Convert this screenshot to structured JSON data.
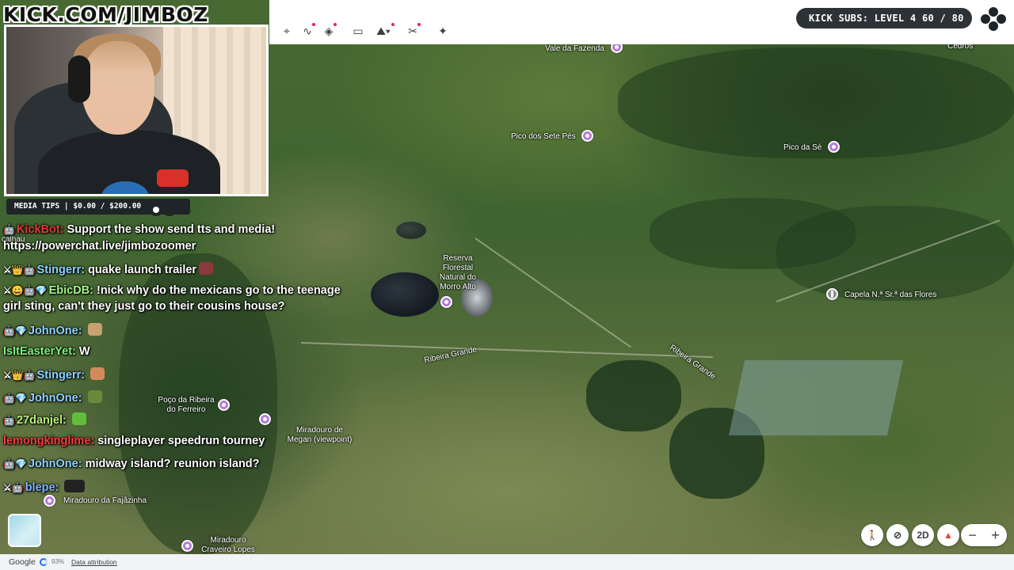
{
  "stream": {
    "brand": "KICK.COM/JIMBOZ",
    "media_tips": "MEDIA TIPS | $0.00 / $200.00",
    "kick_subs": "KICK SUBS: LEVEL 4 60 / 80"
  },
  "map": {
    "places": {
      "vale_da_fazenda": "Vale da Fazenda",
      "cedros": "Cedros",
      "pico_dos_sete_pes": "Pico dos Sete Pés",
      "pico_da_se": "Pico da Sé",
      "reserva": "Reserva\nFlorestal\nNatural do\nMorro Alto",
      "capela": "Capela N.ª Sr.ª das Flores",
      "ribeira_grande_1": "Ribeira Grande",
      "ribeira_grande_2": "Ribeira Grande",
      "poco_da_ribeira": "Poço da Ribeira\ndo Ferreiro",
      "miradouro_megan": "Miradouro de\nMegan (viewpoint)",
      "miradouro_fajazinha": "Miradouro da Fajãzinha",
      "miradouro_craveiro": "Miradouro\nCraveiro Lopes",
      "calhau": "calhau"
    },
    "controls": {
      "btn_2d": "2D"
    }
  },
  "footer": {
    "google": "Google",
    "percent": "93%",
    "attribution": "Data attribution"
  },
  "chat": {
    "messages": [
      {
        "user": "KickBot:",
        "text": "Support the show send tts and media!",
        "user_color": "#e33a3a"
      },
      {
        "user": "",
        "text": "https://powerchat.live/jimbozoomer",
        "user_color": "#ffffff"
      },
      {
        "user": "Stingerr:",
        "text": "quake launch trailer",
        "user_color": "#8fd3ff"
      },
      {
        "user": "EbicDB:",
        "text": "!nick why do the mexicans go to the teenage",
        "user_color": "#a6f28b"
      },
      {
        "user": "",
        "text": "girl sting, can't they just go to their cousins house?",
        "user_color": "#ffffff"
      },
      {
        "user": "JohnOne:",
        "text": "",
        "user_color": "#8fd3ff"
      },
      {
        "user": "IsItEasterYet:",
        "text": "W",
        "user_color": "#7ef07e"
      },
      {
        "user": "Stingerr:",
        "text": "",
        "user_color": "#8fd3ff"
      },
      {
        "user": "JohnOne:",
        "text": "",
        "user_color": "#8fd3ff"
      },
      {
        "user": "27danjel:",
        "text": "",
        "user_color": "#b7f27a"
      },
      {
        "user": "lemongkinglime:",
        "text": "singleplayer speedrun tourney",
        "user_color": "#ff3b3b"
      },
      {
        "user": "JohnOne:",
        "text": "midway island? reunion island?",
        "user_color": "#8fd3ff"
      },
      {
        "user": "blepe:",
        "text": "",
        "user_color": "#7fb6ff"
      }
    ]
  },
  "colors": {
    "pin": "#b77bd8",
    "toolbar_bg": "#ffffff",
    "badge_bg": "#2d3236"
  }
}
